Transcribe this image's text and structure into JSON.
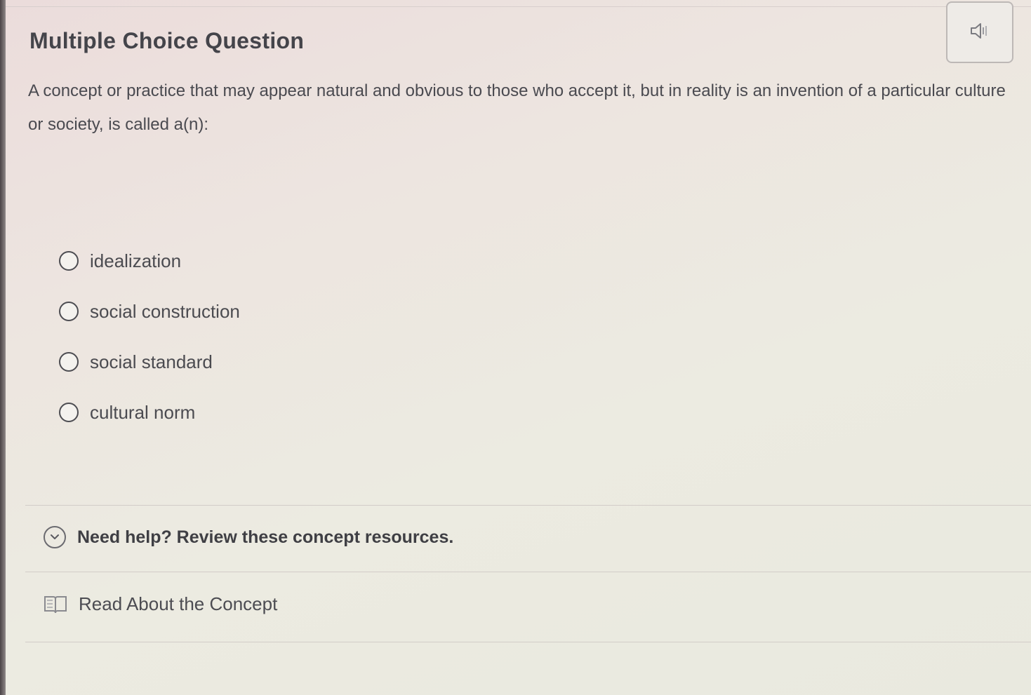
{
  "header": {
    "title": "Multiple Choice Question",
    "audio_icon": "speaker-icon"
  },
  "question": {
    "text": "A concept or practice that may appear natural and obvious to those who accept it, but in reality is an invention of a particular culture or society, is called a(n):"
  },
  "options": [
    {
      "label": "idealization",
      "selected": false
    },
    {
      "label": "social construction",
      "selected": false
    },
    {
      "label": "social standard",
      "selected": false
    },
    {
      "label": "cultural norm",
      "selected": false
    }
  ],
  "help": {
    "icon": "chevron-down-icon",
    "label": "Need help? Review these concept resources."
  },
  "resources": [
    {
      "icon": "book-icon",
      "label": "Read About the Concept"
    }
  ],
  "colors": {
    "text": "#3d3d42",
    "radio_border": "#4d4d52",
    "divider": "#d2ccc8"
  }
}
